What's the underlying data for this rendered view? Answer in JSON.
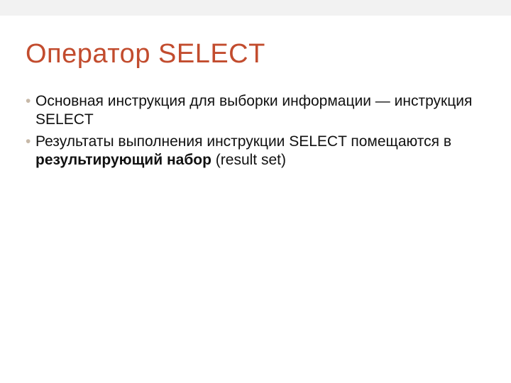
{
  "slide": {
    "title": "Оператор SELECT",
    "bullets": [
      {
        "pre": "Основная инструкция для выборки информации — инструкция SELECT",
        "bold": "",
        "post": ""
      },
      {
        "pre": "Результаты выполнения инструкции SELECT помещаются в ",
        "bold": "результирующий набор",
        "post": " (result set)"
      }
    ]
  },
  "colors": {
    "title": "#c24c2e",
    "bullet_marker": "#c7b9a8",
    "top_bar": "#f2f2f2"
  }
}
